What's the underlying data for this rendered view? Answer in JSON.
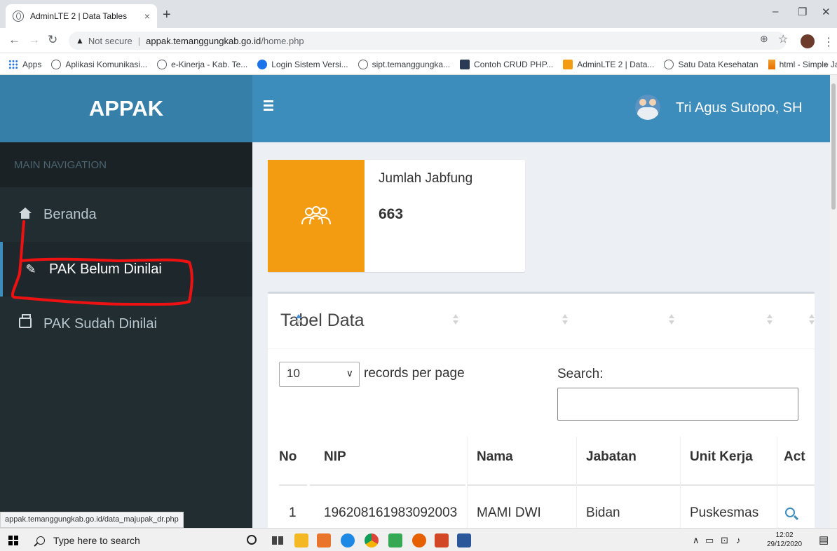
{
  "browser": {
    "tab_title": "AdminLTE 2 | Data Tables",
    "tab_close": "×",
    "new_tab": "+",
    "url_warning": "▲",
    "url_security": "Not secure",
    "url_host": "appak.temanggungkab.go.id",
    "url_path": "/home.php",
    "bookmarks": [
      {
        "label": "Apps",
        "icon": "apps-grid-icon"
      },
      {
        "label": "Aplikasi Komunikasi...",
        "icon": "globe-icon"
      },
      {
        "label": "e-Kinerja - Kab. Te...",
        "icon": "globe-icon"
      },
      {
        "label": "Login Sistem Versi...",
        "icon": "site-icon"
      },
      {
        "label": "sipt.temanggungka...",
        "icon": "globe-icon"
      },
      {
        "label": "Contoh CRUD PHP...",
        "icon": "codepen-icon"
      },
      {
        "label": "AdminLTE 2 | Data...",
        "icon": "adminlte-icon"
      },
      {
        "label": "Satu Data Kesehatan",
        "icon": "globe-icon"
      },
      {
        "label": "html - Simple JavaS...",
        "icon": "stackoverflow-icon"
      }
    ],
    "bookmarks_more": "»",
    "status_url": "appak.temanggungkab.go.id/data_majupak_dr.php"
  },
  "app": {
    "logo": "APPAK",
    "user_name": "Tri Agus Sutopo, SH",
    "accent_color": "#3c8dbc"
  },
  "sidebar": {
    "header": "MAIN NAVIGATION",
    "items": [
      {
        "label": "Beranda",
        "icon": "home-icon"
      },
      {
        "label": "PAK Belum Dinilai",
        "icon": "pencil-icon"
      },
      {
        "label": "PAK Sudah Dinilai",
        "icon": "print-icon"
      }
    ]
  },
  "info_box": {
    "label": "Jumlah Jabfung",
    "value": "663",
    "icon": "users-icon",
    "color": "#f39c12"
  },
  "table": {
    "title": "Tabel Data",
    "length_value": "10",
    "length_label": "records per page",
    "search_label": "Search:",
    "columns": [
      "No",
      "NIP",
      "Nama",
      "Jabatan",
      "Unit Kerja",
      "Act"
    ],
    "rows": [
      {
        "no": "1",
        "nip": "196208161983092003",
        "nama": "MAMI DWI ARTI",
        "jabatan": "Bidan Penyelia",
        "unit_kerja": "Puskesmas Bansari"
      }
    ]
  },
  "taskbar": {
    "search_placeholder": "Type here to search",
    "time": "12:02",
    "date": "29/12/2020"
  }
}
